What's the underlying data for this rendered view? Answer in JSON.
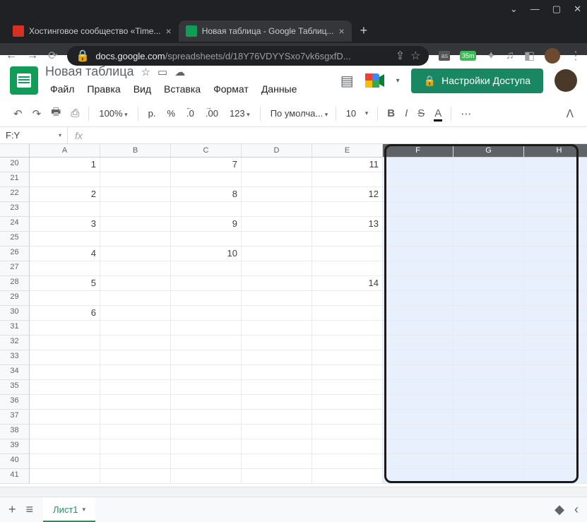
{
  "browser": {
    "tabs": [
      {
        "title": "Хостинговое сообщество «Time...",
        "active": false
      },
      {
        "title": "Новая таблица - Google Таблиц...",
        "active": true
      }
    ],
    "url_prefix": "docs.google.com",
    "url_suffix": "/spreadsheets/d/18Y76VDYYSxo7vk6sgxfD...",
    "ext_badge": "35m"
  },
  "sheets": {
    "title": "Новая таблица",
    "menus": [
      "Файл",
      "Правка",
      "Вид",
      "Вставка",
      "Формат",
      "Данные"
    ],
    "share_label": "Настройки Доступа"
  },
  "toolbar": {
    "zoom": "100%",
    "currency": "р.",
    "percent": "%",
    "dec_dec": ".0",
    "inc_dec": ".00",
    "format123": "123",
    "font": "По умолча...",
    "font_size": "10"
  },
  "name_box": "F:Y",
  "fx": "fx",
  "columns": [
    "A",
    "B",
    "C",
    "D",
    "E",
    "F",
    "G",
    "H"
  ],
  "selected_cols": [
    "F",
    "G",
    "H"
  ],
  "rows": [
    20,
    21,
    22,
    23,
    24,
    25,
    26,
    27,
    28,
    29,
    30,
    31,
    32,
    33,
    34,
    35,
    36,
    37,
    38,
    39,
    40,
    41
  ],
  "cells": {
    "20": {
      "A": "1",
      "C": "7",
      "E": "11"
    },
    "22": {
      "A": "2",
      "C": "8",
      "E": "12"
    },
    "24": {
      "A": "3",
      "C": "9",
      "E": "13"
    },
    "26": {
      "A": "4",
      "C": "10"
    },
    "28": {
      "A": "5",
      "E": "14"
    },
    "30": {
      "A": "6"
    }
  },
  "sheet_tab": "Лист1"
}
